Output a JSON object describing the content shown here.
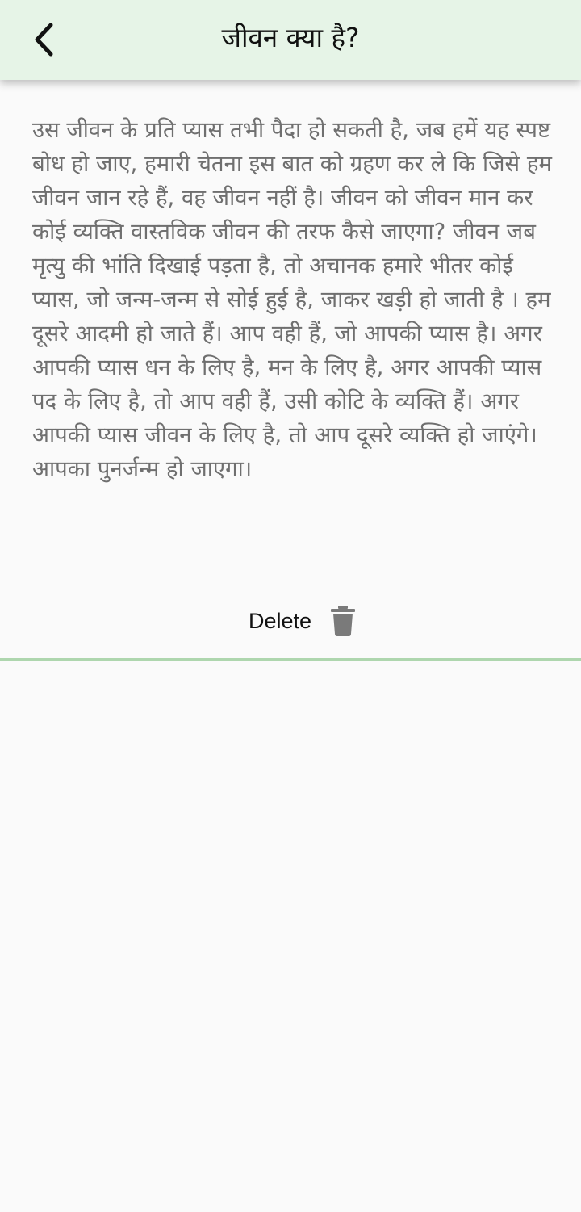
{
  "header": {
    "title": "जीवन क्या है?",
    "back_icon": "chevron-left-icon"
  },
  "note": {
    "body": "उस जीवन के प्रति प्यास तभी पैदा हो सकती है, जब हमें यह स्पष्ट बोध हो जाए, हमारी चेतना इस बात को ग्रहण कर ले कि जिसे हम जीवन जान रहे हैं, वह जीवन नहीं है। जीवन को जीवन मान कर कोई व्यक्ति वास्तविक जीवन की तरफ कैसे जाएगा? जीवन जब मृत्यु की भांति दिखाई पड़ता है, तो अचानक हमारे भीतर कोई प्यास, जो जन्म-जन्म से सोई हुई है, जाकर खड़ी हो जाती है । हम दूसरे आदमी हो जाते हैं। आप वही हैं, जो आपकी प्यास है। अगर आपकी प्यास धन के लिए है, मन के लिए है, अगर आपकी प्यास पद के लिए है, तो आप वही हैं, उसी कोटि के व्यक्ति हैं। अगर आपकी प्यास जीवन के लिए है, तो आप दूसरे व्यक्ति हो जाएंगे। आपका पुनर्जन्म हो जाएगा।"
  },
  "actions": {
    "delete_label": "Delete",
    "delete_icon": "trash-icon"
  },
  "colors": {
    "app_bar_bg": "#e6f4e7",
    "divider": "#aed6ae",
    "body_text": "#6f6f6f",
    "icon_gray": "#7a7a7a"
  }
}
